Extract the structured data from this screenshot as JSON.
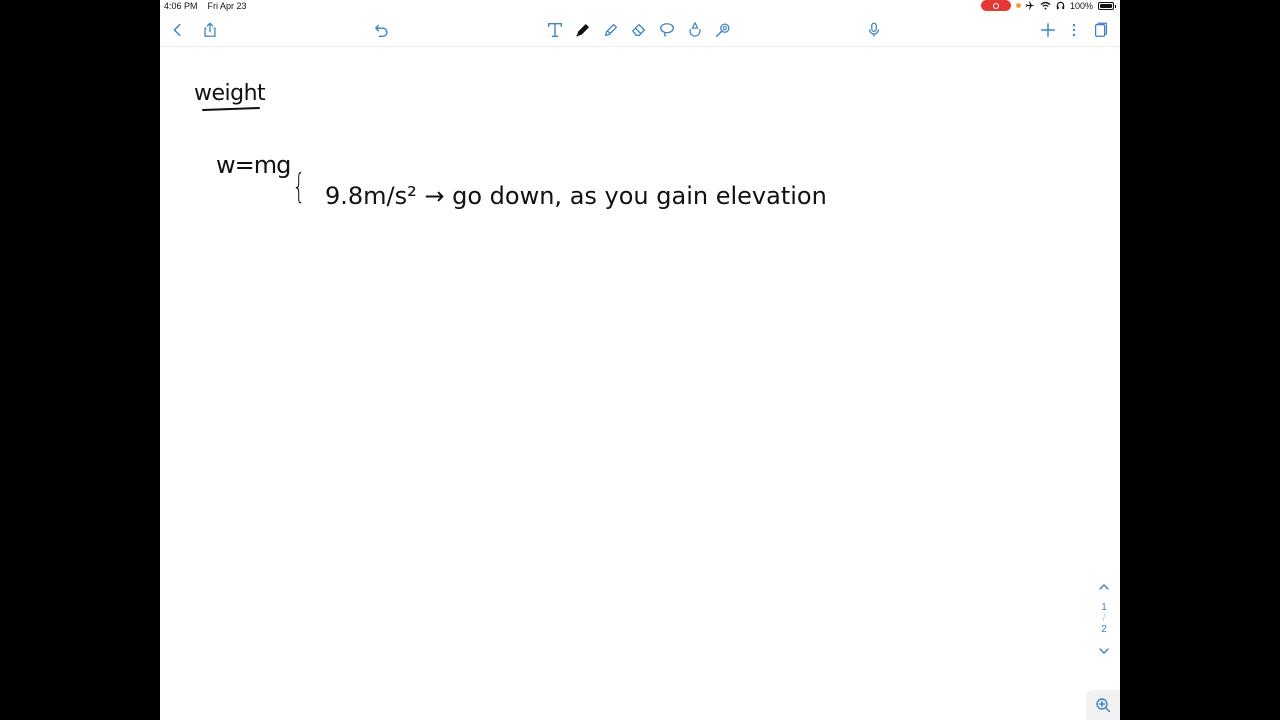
{
  "status_bar": {
    "time": "4:06 PM",
    "date": "Fri Apr 23",
    "battery": "100%",
    "battery_level": 1.0
  },
  "toolbar": {
    "left": [
      "back-icon",
      "share-icon"
    ],
    "undo": "undo-icon",
    "tools": [
      "text-tool-icon",
      "pen-tool-icon",
      "highlighter-tool-icon",
      "eraser-tool-icon",
      "lasso-tool-icon",
      "shapes-tool-icon",
      "laser-pointer-icon"
    ],
    "right": [
      "microphone-icon",
      "add-page-icon",
      "more-options-icon",
      "page-thumbnails-icon"
    ]
  },
  "note": {
    "title": "weight",
    "formula": "w=mg",
    "brace": "{",
    "line": "9.8m/s² → go down, as you gain elevation"
  },
  "pagination": {
    "current": "1",
    "separator": "/",
    "total": "2"
  },
  "colors": {
    "accent": "#3a82c4",
    "ink": "#111111",
    "record": "#e53935"
  }
}
